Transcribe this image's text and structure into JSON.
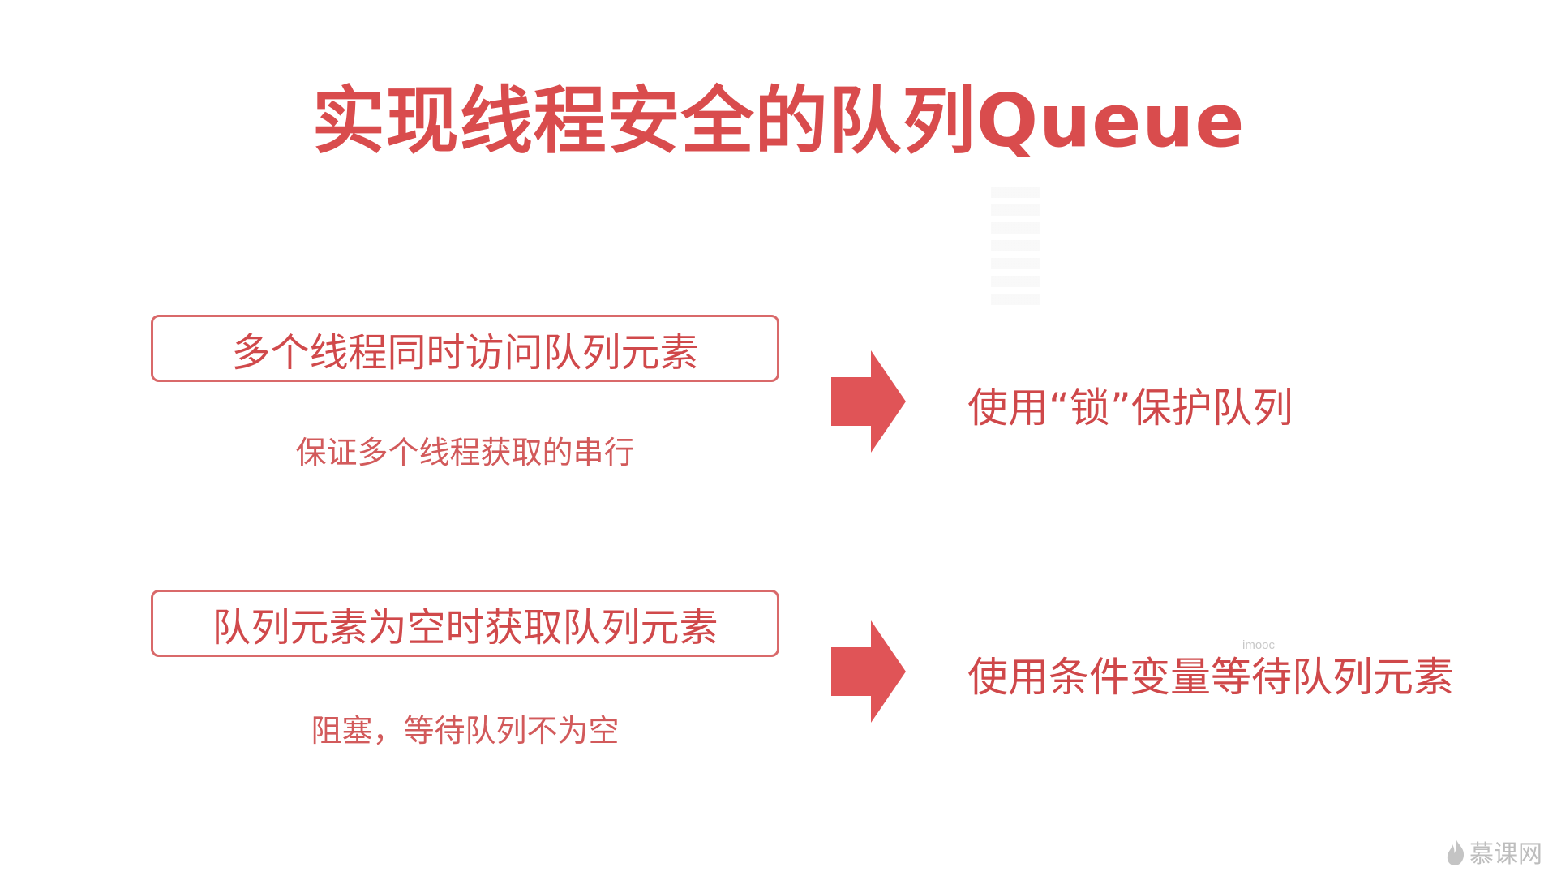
{
  "title": "实现线程安全的队列Queue",
  "rows": [
    {
      "problem": "多个线程同时访问队列元素",
      "note": "保证多个线程获取的串行",
      "solution": "使用“锁”保护队列"
    },
    {
      "problem": "队列元素为空时获取队列元素",
      "note": "阻塞，等待队列不为空",
      "solution": "使用条件变量等待队列元素"
    }
  ],
  "watermark_small": "imooc",
  "logo_text": "慕课网",
  "colors": {
    "accent": "#d94c4d",
    "arrow": "#e05457",
    "box_border": "#d9696a"
  }
}
